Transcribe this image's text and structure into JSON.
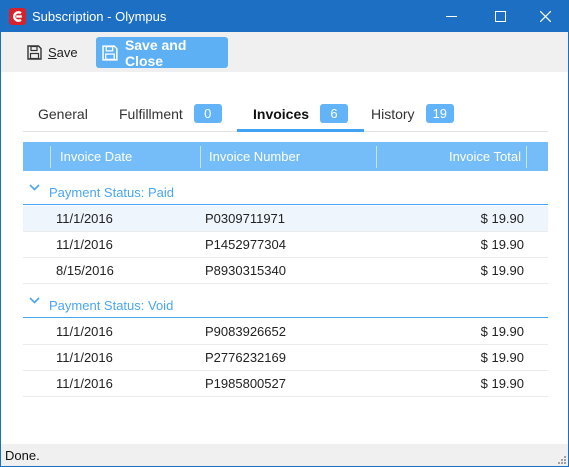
{
  "window": {
    "title": "Subscription - Olympus"
  },
  "toolbar": {
    "save_label": "Save",
    "save_close_label": "Save and Close"
  },
  "tabs": [
    {
      "label": "General",
      "badge": null,
      "active": false
    },
    {
      "label": "Fulfillment",
      "badge": "0",
      "active": false
    },
    {
      "label": "Invoices",
      "badge": "6",
      "active": true
    },
    {
      "label": "History",
      "badge": "19",
      "active": false
    }
  ],
  "grid": {
    "columns": [
      "Invoice Date",
      "Invoice Number",
      "Invoice Total"
    ],
    "groups": [
      {
        "title": "Payment Status: Paid",
        "rows": [
          {
            "date": "11/1/2016",
            "number": "P0309711971",
            "total": "$ 19.90"
          },
          {
            "date": "11/1/2016",
            "number": "P1452977304",
            "total": "$ 19.90"
          },
          {
            "date": "8/15/2016",
            "number": "P8930315340",
            "total": "$ 19.90"
          }
        ]
      },
      {
        "title": "Payment Status: Void",
        "rows": [
          {
            "date": "11/1/2016",
            "number": "P9083926652",
            "total": "$ 19.90"
          },
          {
            "date": "11/1/2016",
            "number": "P2776232169",
            "total": "$ 19.90"
          },
          {
            "date": "11/1/2016",
            "number": "P1985800527",
            "total": "$ 19.90"
          }
        ]
      }
    ]
  },
  "status": {
    "text": "Done."
  },
  "colors": {
    "titlebar": "#1d6fc4",
    "accent": "#62b3f7",
    "grid_header": "#75bdf8",
    "app_icon": "#d6222a"
  },
  "icons": {
    "app": "app-logo-icon",
    "minimize": "minimize-icon",
    "maximize": "maximize-icon",
    "close": "close-icon",
    "save": "floppy-disk-icon",
    "collapse": "chevron-down-icon",
    "grip": "resize-grip-icon"
  }
}
